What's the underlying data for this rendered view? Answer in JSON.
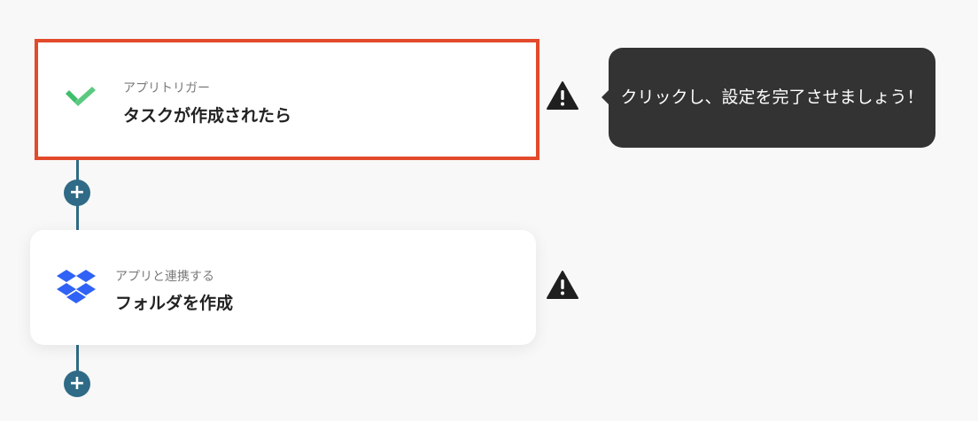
{
  "steps": [
    {
      "category": "アプリトリガー",
      "title": "タスクが作成されたら",
      "app_icon": "wrike-check-icon",
      "selected": true,
      "warning": true
    },
    {
      "category": "アプリと連携する",
      "title": "フォルダを作成",
      "app_icon": "dropbox-icon",
      "selected": false,
      "warning": true
    }
  ],
  "tooltip": {
    "text": "クリックし、設定を完了させましょう！"
  },
  "add_button": {
    "symbol": "+"
  },
  "colors": {
    "background": "#f8f8f8",
    "selected_border": "#e24a2b",
    "connector": "#2f6b86",
    "tooltip_bg": "#333333",
    "wrike_green": "#3fbf6a",
    "dropbox_blue": "#2f62f5"
  }
}
